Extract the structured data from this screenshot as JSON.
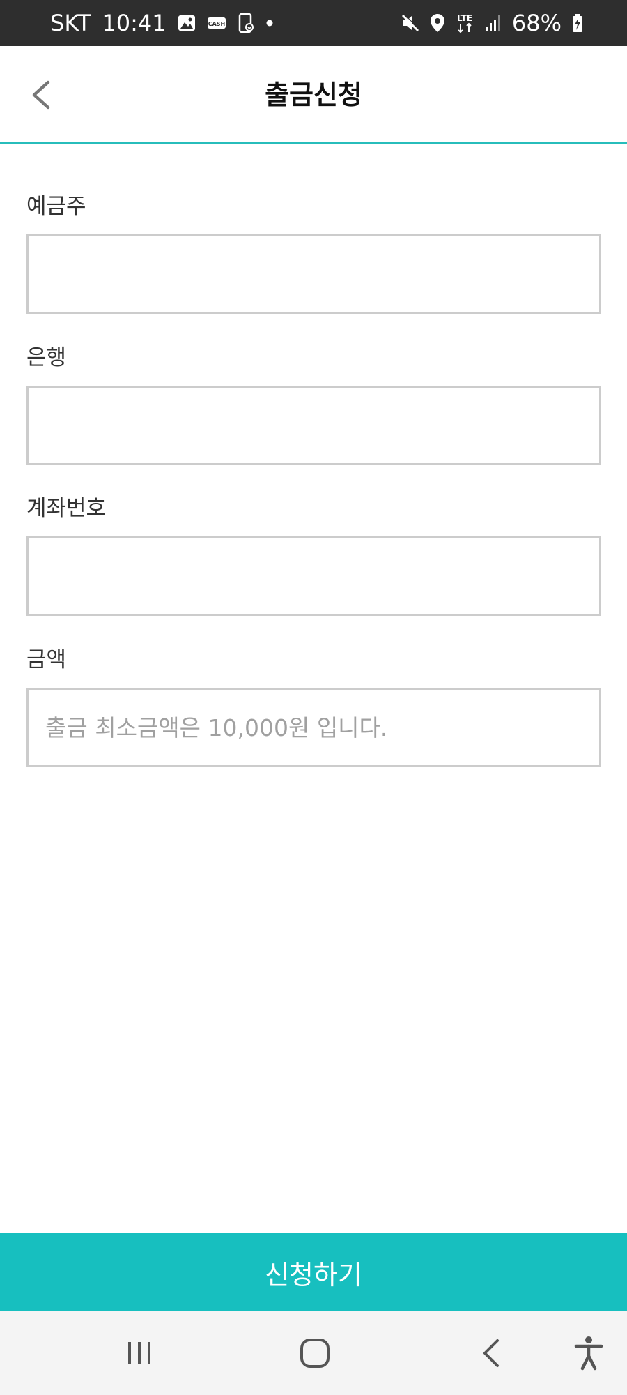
{
  "status_bar": {
    "carrier": "SKT",
    "time": "10:41",
    "left_icons": [
      "gallery-icon",
      "cash-icon",
      "phone-sync-icon",
      "dot-icon"
    ],
    "right_icons": [
      "mute-icon",
      "location-icon",
      "lte-icon",
      "signal-icon",
      "battery-charging-icon"
    ],
    "battery": "68%",
    "network": "LTE"
  },
  "header": {
    "back_icon": "chevron-left-icon",
    "title": "출금신청"
  },
  "form": {
    "fields": [
      {
        "label": "예금주",
        "value": "",
        "placeholder": ""
      },
      {
        "label": "은행",
        "value": "",
        "placeholder": ""
      },
      {
        "label": "계좌번호",
        "value": "",
        "placeholder": ""
      },
      {
        "label": "금액",
        "value": "",
        "placeholder": "출금 최소금액은 10,000원 입니다."
      }
    ]
  },
  "submit_label": "신청하기",
  "nav_bar": {
    "icons": [
      "recent-apps-icon",
      "home-icon",
      "back-icon",
      "accessibility-icon"
    ]
  },
  "colors": {
    "accent": "#17bfbf",
    "header_underline": "#27bdbb",
    "status_bar_bg": "#2e2e2e",
    "input_border": "#cccccc",
    "placeholder": "#a0a0a0",
    "nav_bar_bg": "#f4f4f4"
  }
}
